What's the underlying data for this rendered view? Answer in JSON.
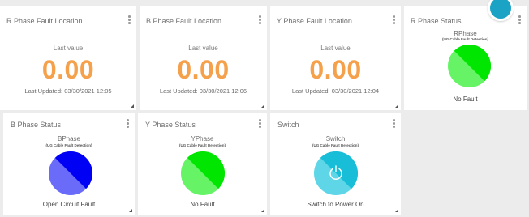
{
  "cards": {
    "r_fault": {
      "title": "R Phase Fault Location",
      "label": "Last value",
      "value": "0.00",
      "updated": "Last Updated: 03/30/2021 12:05"
    },
    "b_fault": {
      "title": "B Phase Fault Location",
      "label": "Last value",
      "value": "0.00",
      "updated": "Last Updated: 03/30/2021 12:06"
    },
    "y_fault": {
      "title": "Y Phase Fault Location",
      "label": "Last value",
      "value": "0.00",
      "updated": "Last Updated: 03/30/2021 12:04"
    },
    "r_status": {
      "title": "R Phase Status",
      "name": "RPhase",
      "sub": "(UG Cable Fault Detection)",
      "status": "No Fault",
      "colors": {
        "dark": "#00e600",
        "light": "#66f466"
      }
    },
    "b_status": {
      "title": "B Phase Status",
      "name": "BPhase",
      "sub": "(UG Cable Fault Detection)",
      "status": "Open Circuit Fault",
      "colors": {
        "dark": "#0000f5",
        "light": "#6b6bfa"
      }
    },
    "y_status": {
      "title": "Y Phase Status",
      "name": "YPhase",
      "sub": "(UG Cable Fault Detection)",
      "status": "No Fault",
      "colors": {
        "dark": "#00e600",
        "light": "#66f466"
      }
    },
    "switch": {
      "title": "Switch",
      "name": "Switch",
      "sub": "(UG Cable Fault Detection)",
      "status": "Switch to Power On",
      "icon": "power-icon",
      "colors": {
        "dark": "#18bed8",
        "light": "#5fd6e8"
      }
    }
  },
  "accent_colors": {
    "value_orange": "#f5a04b",
    "badge_teal": "#1aa3c4"
  }
}
